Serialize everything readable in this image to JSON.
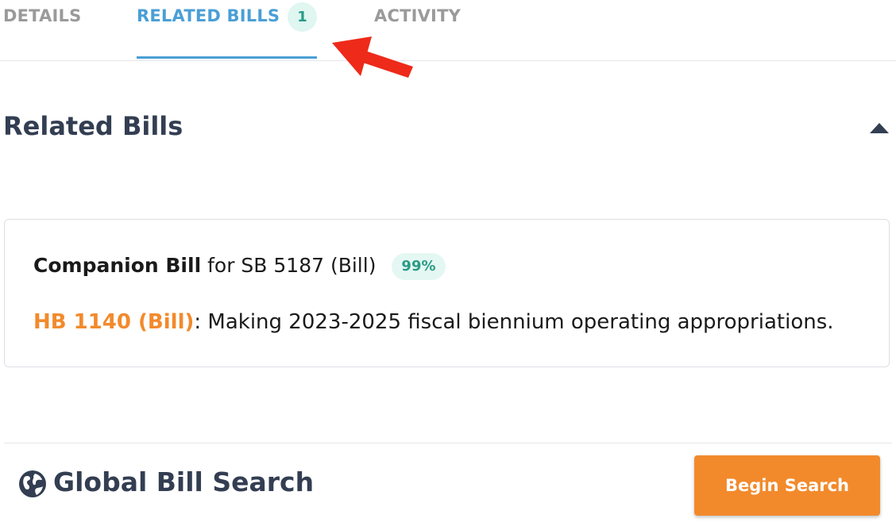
{
  "tabs": [
    {
      "label": "DETAILS"
    },
    {
      "label": "RELATED BILLS",
      "badge": "1",
      "active": true
    },
    {
      "label": "ACTIVITY"
    }
  ],
  "section": {
    "title": "Related Bills"
  },
  "related_bill": {
    "relation_type": "Companion Bill",
    "relation_target": " for SB 5187 (Bill)",
    "match_percent": "99%",
    "bill_link": "HB 1140 (Bill)",
    "bill_separator": ":",
    "bill_description": " Making 2023-2025 fiscal biennium operating appropriations."
  },
  "global_search": {
    "title": "Global Bill Search",
    "button_label": "Begin Search"
  },
  "colors": {
    "active_tab": "#4a9fd6",
    "accent_orange": "#f28a2c",
    "badge_teal": "#2a9b86",
    "heading": "#333e52",
    "annotation_arrow": "#ee2a1a"
  },
  "icons": {
    "collapse": "caret-up-icon",
    "globe": "globe-icon",
    "annotation": "red-arrow-annotation"
  }
}
